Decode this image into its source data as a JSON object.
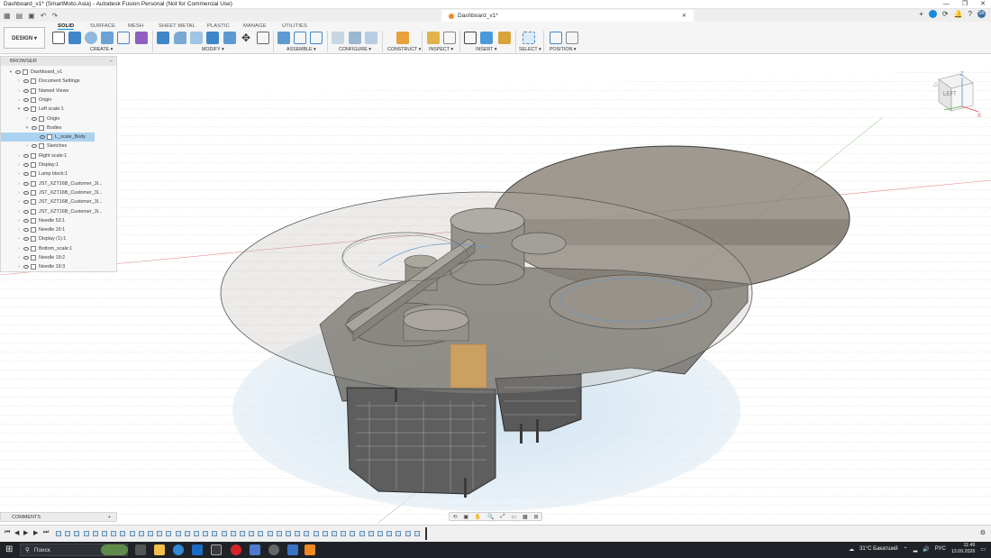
{
  "window": {
    "title": "Dashboard_v1* (SmartMoto.Asia) - Autodesk Fusion Personal (Not for Commercial Use)",
    "doc_tab": "Dashboard_v1*"
  },
  "workspace": {
    "label": "DESIGN ▾"
  },
  "ribbon_tabs": [
    "SOLID",
    "SURFACE",
    "MESH",
    "SHEET METAL",
    "PLASTIC",
    "MANAGE",
    "UTILITIES"
  ],
  "ribbon_groups": {
    "create": "CREATE ▾",
    "modify": "MODIFY ▾",
    "assemble": "ASSEMBLE ▾",
    "configure": "CONFIGURE ▾",
    "construct": "CONSTRUCT ▾",
    "inspect": "INSPECT ▾",
    "insert": "INSERT ▾",
    "select": "SELECT ▾",
    "position": "POSITION ▾"
  },
  "browser": {
    "title": "BROWSER",
    "items": [
      {
        "label": "Dashboard_v1",
        "indent": 0,
        "arrow": "▾"
      },
      {
        "label": "Document Settings",
        "indent": 1,
        "arrow": "›"
      },
      {
        "label": "Named Views",
        "indent": 1,
        "arrow": "›"
      },
      {
        "label": "Origin",
        "indent": 1,
        "arrow": "›"
      },
      {
        "label": "Left scale:1",
        "indent": 1,
        "arrow": "▾"
      },
      {
        "label": "Origin",
        "indent": 2,
        "arrow": "›"
      },
      {
        "label": "Bodies",
        "indent": 2,
        "arrow": "▾"
      },
      {
        "label": "L_scale_Body",
        "indent": 3,
        "arrow": "",
        "selected": true
      },
      {
        "label": "Sketches",
        "indent": 2,
        "arrow": "›"
      },
      {
        "label": "Right scale:1",
        "indent": 1,
        "arrow": "›"
      },
      {
        "label": "Display:1",
        "indent": 1,
        "arrow": "›"
      },
      {
        "label": "Lamp block:1",
        "indent": 1,
        "arrow": "›"
      },
      {
        "label": "JST_XZT16B_Customer_3l...",
        "indent": 1,
        "arrow": "›"
      },
      {
        "label": "JST_XZT16B_Customer_3l...",
        "indent": 1,
        "arrow": "›"
      },
      {
        "label": "JST_XZT16B_Customer_3l...",
        "indent": 1,
        "arrow": "›"
      },
      {
        "label": "JST_XZT16B_Customer_3l...",
        "indent": 1,
        "arrow": "›"
      },
      {
        "label": "Needle 53:1",
        "indent": 1,
        "arrow": "›"
      },
      {
        "label": "Needle 19:1",
        "indent": 1,
        "arrow": "›"
      },
      {
        "label": "Display (1):1",
        "indent": 1,
        "arrow": "›"
      },
      {
        "label": "Bottom_scale:1",
        "indent": 1,
        "arrow": "›"
      },
      {
        "label": "Needle 19:2",
        "indent": 1,
        "arrow": "›"
      },
      {
        "label": "Needle 19:3",
        "indent": 1,
        "arrow": "›"
      }
    ]
  },
  "viewcube": {
    "face": "LEFT",
    "axes": {
      "z": "Z",
      "x": "X"
    }
  },
  "comments": {
    "label": "COMMENTS",
    "add": "+"
  },
  "taskbar": {
    "search_placeholder": "Поиск",
    "weather": "31°C Бакатший",
    "lang": "РУС",
    "time": "11:49",
    "date": "13.09.2026"
  },
  "colors": {
    "accent": "#0696d7",
    "model": "#8a8680",
    "dark": "#5c5c5c"
  }
}
